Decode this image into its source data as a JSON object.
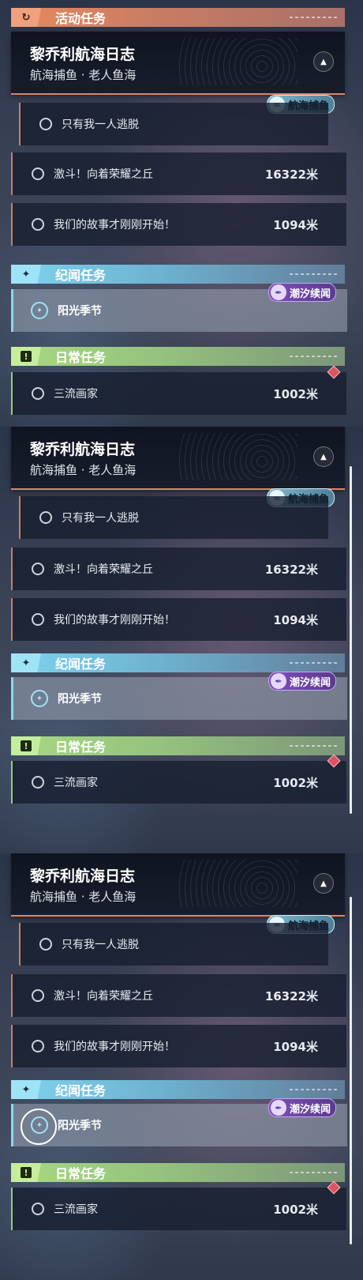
{
  "activity_section": {
    "label": "活动任务",
    "icon": "activity-refresh-icon",
    "accent": "#e6895f"
  },
  "main_quest": {
    "title": "黎乔利航海日志",
    "subtitle": "航海捕鱼 · 老人鱼海",
    "collapse_icon": "chevron-up-icon"
  },
  "fishing_tag": {
    "label": "航海捕鱼",
    "icon": "wave-icon"
  },
  "activity_tasks": [
    {
      "name": "只有我一人逃脱",
      "distance": ""
    },
    {
      "name": "激斗！向着荣耀之丘",
      "distance": "16322米"
    },
    {
      "name": "我们的故事才刚刚开始！",
      "distance": "1094米"
    }
  ],
  "story_section": {
    "label": "纪闻任务",
    "icon": "sparkle-icon",
    "accent": "#7fd3ee"
  },
  "tide_tag": {
    "label": "潮汐续闻",
    "icon": "quill-icon"
  },
  "story_task": {
    "name": "阳光季节",
    "icon": "compass-star-icon"
  },
  "daily_section": {
    "label": "日常任务",
    "icon": "exclamation-icon",
    "accent": "#a8d883"
  },
  "daily_task": {
    "name": "三流画家",
    "distance": "1002米",
    "badge_color": "#d9555f"
  }
}
